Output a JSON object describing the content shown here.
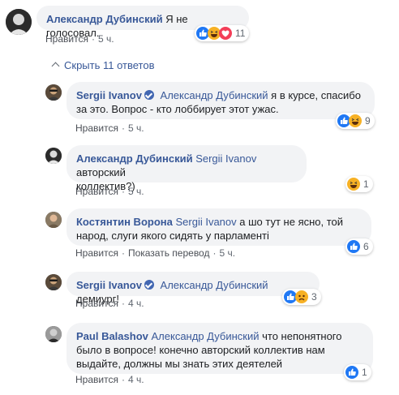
{
  "top_comment": {
    "author": "Александр Дубинский",
    "text": "Я не голосовал.",
    "like_label": "Нравится",
    "time": "5 ч.",
    "reaction_count": "11"
  },
  "toggle_label": "Скрыть 11 ответов",
  "replies": [
    {
      "author": "Sergii Ivanov",
      "mention": "Александр Дубинский",
      "text_line1": "я в курсе, спасибо",
      "text_line2": "за это. Вопрос - кто лоббирует этот ужас.",
      "like_label": "Нравится",
      "time": "5 ч.",
      "reaction_count": "9"
    },
    {
      "author": "Александр Дубинский",
      "mention": "Sergii Ivanov",
      "text_line1": "авторский",
      "text_line2": "коллектив?)",
      "like_label": "Нравится",
      "time": "5 ч.",
      "reaction_count": "1"
    },
    {
      "author": "Костянтин Ворона",
      "mention": "Sergii Ivanov",
      "text_line1": "а шо тут не ясно, той",
      "text_line2": "народ, слуги якого сидять у парламенті",
      "like_label": "Нравится",
      "translate_label": "Показать перевод",
      "time": "5 ч.",
      "reaction_count": "6"
    },
    {
      "author": "Sergii Ivanov",
      "mention": "Александр Дубинский",
      "text_line1": "демиург!",
      "like_label": "Нравится",
      "time": "4 ч.",
      "reaction_count": "3"
    },
    {
      "author": "Paul Balashov",
      "mention": "Александр Дубинский",
      "text_line1": "что непонятного",
      "text_line2": "было в вопросе! конечно авторский коллектив нам",
      "text_line3": "выдайте, должны мы знать этих деятелей",
      "like_label": "Нравится",
      "time": "4 ч.",
      "reaction_count": "1"
    }
  ],
  "colors": {
    "link": "#385898",
    "bubble": "#f2f3f5",
    "like_blue": "#2078f4",
    "haha_yellow": "#f7b125",
    "love_red": "#f33e58"
  },
  "icons": [
    "like-icon",
    "haha-icon",
    "love-icon",
    "sad-icon",
    "verified-icon",
    "chevron-up-icon"
  ]
}
